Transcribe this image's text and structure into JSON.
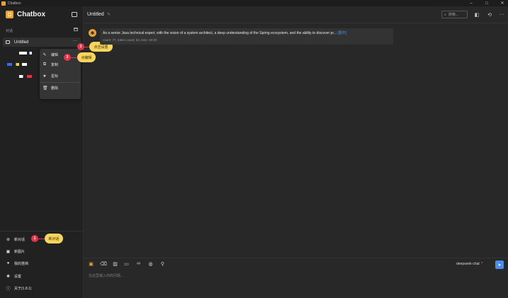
{
  "window": {
    "title": "Chatbox",
    "controls": [
      "–",
      "□",
      "✕"
    ]
  },
  "sidebar": {
    "brand": "Chatbox",
    "section_label": "对话",
    "sessions": [
      {
        "title": "Untitled",
        "more": "···"
      }
    ],
    "context_menu": [
      {
        "icon": "pencil-icon",
        "glyph": "✎",
        "label": "编辑"
      },
      {
        "icon": "copy-icon",
        "glyph": "⧉",
        "label": "复制"
      },
      {
        "icon": "star-icon",
        "glyph": "★",
        "label": "星标"
      },
      {
        "icon": "trash-icon",
        "glyph": "🗑",
        "label": "删除"
      }
    ],
    "bottom_items": [
      {
        "icon": "plus-circle-icon",
        "glyph": "⊕",
        "label": "新对话"
      },
      {
        "icon": "image-icon",
        "glyph": "▣",
        "label": "新图片"
      },
      {
        "icon": "bot-icon",
        "glyph": "●",
        "label": "我的搭档"
      },
      {
        "icon": "gear-icon",
        "glyph": "✱",
        "label": "设置"
      },
      {
        "icon": "info-icon",
        "glyph": "ⓘ",
        "label": "关于(1.8.1)"
      }
    ]
  },
  "annotations": [
    {
      "num": "1",
      "text": "新对话"
    },
    {
      "num": "2",
      "text": "点击设置"
    },
    {
      "num": "3",
      "text": "点编辑"
    }
  ],
  "header": {
    "title": "Untitled",
    "search_placeholder": "搜索..."
  },
  "message": {
    "text": "As a senior Java technical expert, with the vision of a system architect, a deep understanding of the Spring ecosystem, and the ability to discover pr...",
    "expand": "[展开]",
    "meta": "count: 77, token count: 83, time: 20:00"
  },
  "composer": {
    "model": "deepseek-chat ⌃",
    "placeholder": "在这里输入你的问题...",
    "send": "➤"
  }
}
